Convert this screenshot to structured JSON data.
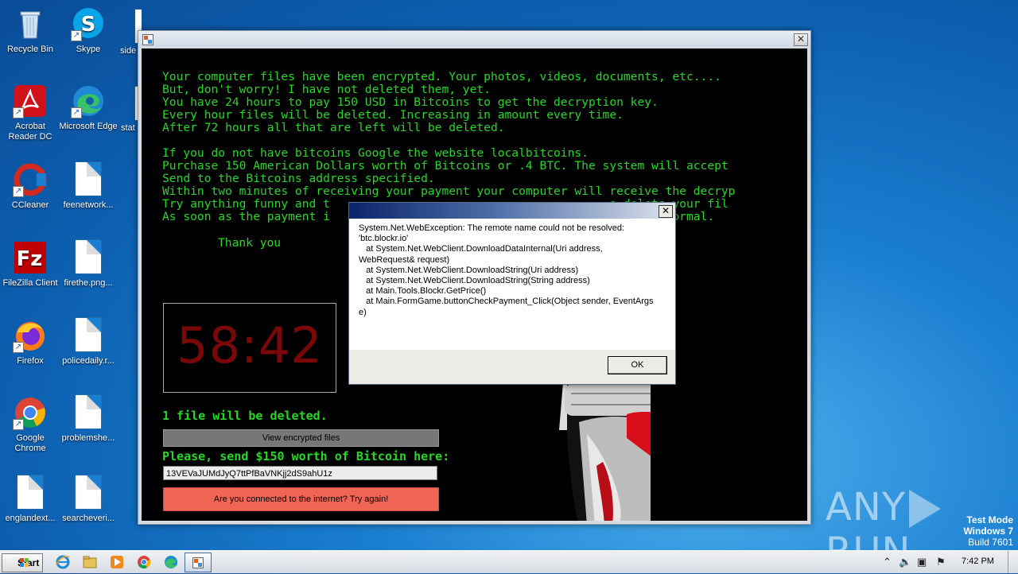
{
  "desktop": {
    "icons": [
      {
        "label": "Recycle Bin"
      },
      {
        "label": "Skype"
      },
      {
        "label": "side"
      },
      {
        "label": "Acrobat Reader DC"
      },
      {
        "label": "Microsoft Edge"
      },
      {
        "label": "stat"
      },
      {
        "label": "CCleaner"
      },
      {
        "label": "feenetwork..."
      },
      {
        "label": "FileZilla Client"
      },
      {
        "label": "firethe.png..."
      },
      {
        "label": "Firefox"
      },
      {
        "label": "policedaily.r..."
      },
      {
        "label": "Google Chrome"
      },
      {
        "label": "problemshe..."
      },
      {
        "label": "englandext..."
      },
      {
        "label": "searcheveri..."
      }
    ]
  },
  "ransom_window": {
    "message_lines": [
      "Your computer files have been encrypted. Your photos, videos, documents, etc....",
      "But, don't worry! I have not deleted them, yet.",
      "You have 24 hours to pay 150 USD in Bitcoins to get the decryption key.",
      "Every hour files will be deleted. Increasing in amount every time.",
      "After 72 hours all that are left will be deleted.",
      "",
      "If you do not have bitcoins Google the website localbitcoins.",
      "Purchase 150 American Dollars worth of Bitcoins or .4 BTC. The system will accept",
      "Send to the Bitcoins address specified.",
      "Within two minutes of receiving your payment your computer will receive the decryp",
      "Try anything funny and t                                        o delete your fil",
      "As soon as the payment i                                        rned to normal."
    ],
    "thank_you": "Thank you",
    "timer": "58:42",
    "files_deleted": "1 file will be deleted.",
    "view_files_button": "View encrypted files",
    "send_label": "Please, send $150 worth of Bitcoin here:",
    "bitcoin_address": "13VEVaJUMdJyQ7ttPfBaVNKjj2dS9ahU1z",
    "check_button": "Are you connected to the internet? Try again!"
  },
  "error_dialog": {
    "message": "System.Net.WebException: The remote name could not be resolved:\n'btc.blockr.io'\n   at System.Net.WebClient.DownloadDataInternal(Uri address,\nWebRequest& request)\n   at System.Net.WebClient.DownloadString(Uri address)\n   at System.Net.WebClient.DownloadString(String address)\n   at Main.Tools.Blockr.GetPrice()\n   at Main.FormGame.buttonCheckPayment_Click(Object sender, EventArgs\ne)",
    "ok_button": "OK"
  },
  "watermark": {
    "brand_left": "ANY",
    "brand_right": "RUN",
    "mode": "Test Mode",
    "os": "Windows 7",
    "build": "Build 7601"
  },
  "taskbar": {
    "start_label": "Start",
    "clock": "7:42 PM"
  }
}
